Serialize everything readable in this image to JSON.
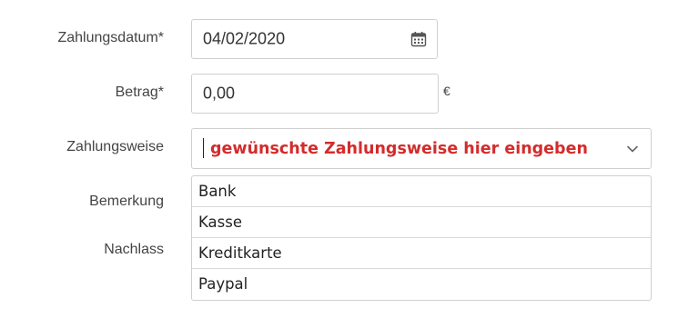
{
  "form": {
    "payment_date": {
      "label": "Zahlungsdatum*",
      "value": "04/02/2020",
      "icon": "calendar-icon"
    },
    "amount": {
      "label": "Betrag*",
      "value": "0,00",
      "currency": "€"
    },
    "payment_method": {
      "label": "Zahlungsweise",
      "placeholder": "gewünschte Zahlungsweise hier eingeben",
      "placeholder_color": "#d32c2c",
      "icon": "chevron-down-icon",
      "options": [
        "Bank",
        "Kasse",
        "Kreditkarte",
        "Paypal"
      ]
    },
    "remark": {
      "label": "Bemerkung"
    },
    "discount": {
      "label": "Nachlass"
    }
  }
}
